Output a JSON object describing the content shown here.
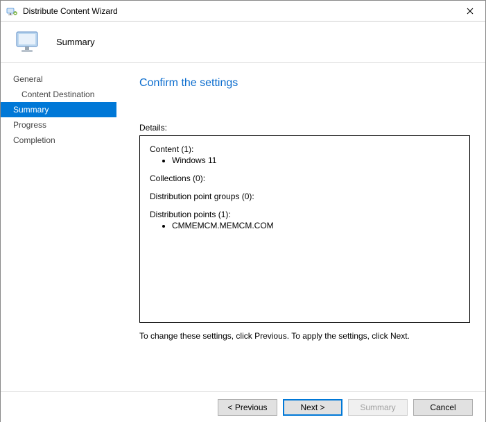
{
  "window": {
    "title": "Distribute Content Wizard"
  },
  "banner": {
    "title": "Summary"
  },
  "nav": {
    "items": [
      {
        "label": "General",
        "sub": false,
        "active": false
      },
      {
        "label": "Content Destination",
        "sub": true,
        "active": false
      },
      {
        "label": "Summary",
        "sub": false,
        "active": true
      },
      {
        "label": "Progress",
        "sub": false,
        "active": false
      },
      {
        "label": "Completion",
        "sub": false,
        "active": false
      }
    ]
  },
  "content": {
    "heading": "Confirm the settings",
    "details_label": "Details:",
    "hint": "To change these settings, click Previous. To apply the settings, click Next."
  },
  "details": {
    "content_header": "Content (1):",
    "content_items": [
      "Windows 11"
    ],
    "collections_header": "Collections (0):",
    "dpg_header": "Distribution point groups (0):",
    "dp_header": "Distribution points (1):",
    "dp_items": [
      "CMMEMCM.MEMCM.COM"
    ]
  },
  "buttons": {
    "previous": "< Previous",
    "next": "Next >",
    "summary": "Summary",
    "cancel": "Cancel"
  }
}
